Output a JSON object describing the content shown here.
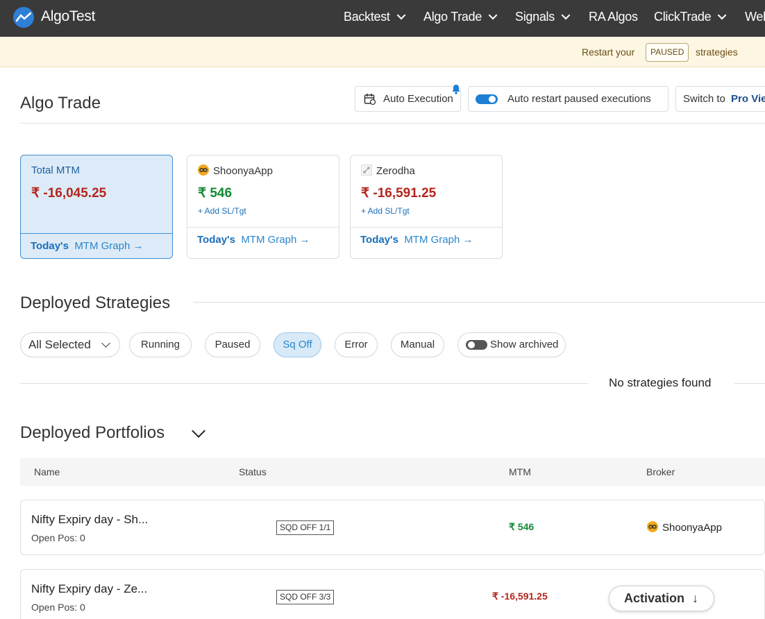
{
  "nav": {
    "brand": "AlgoTest",
    "items": [
      {
        "label": "Backtest"
      },
      {
        "label": "Algo Trade"
      },
      {
        "label": "Signals"
      },
      {
        "label": "RA Algos"
      },
      {
        "label": "ClickTrade"
      },
      {
        "label": "Web"
      }
    ]
  },
  "banner": {
    "prefix": "Restart your",
    "badge": "PAUSED",
    "suffix": "strategies"
  },
  "header": {
    "title": "Algo Trade",
    "auto_execution": "Auto Execution",
    "auto_restart": "Auto restart paused executions",
    "switch_to": "Switch to",
    "switch_target": "Pro Vie"
  },
  "mtm_cards": [
    {
      "label": "Total MTM",
      "amount": "₹ -16,045.25",
      "graph_bold": "Today's",
      "graph_text": "MTM Graph"
    },
    {
      "label": "ShoonyaApp",
      "amount": "₹ 546",
      "add": "+ Add SL/Tgt",
      "graph_bold": "Today's",
      "graph_text": "MTM Graph"
    },
    {
      "label": "Zerodha",
      "amount": "₹ -16,591.25",
      "add": "+ Add SL/Tgt",
      "graph_bold": "Today's",
      "graph_text": "MTM Graph"
    }
  ],
  "strategies": {
    "title": "Deployed Strategies",
    "filters": {
      "select": "All Selected",
      "pills": [
        "Running",
        "Paused",
        "Sq Off",
        "Error",
        "Manual"
      ],
      "active_pill": "Sq Off",
      "archived": "Show archived"
    },
    "empty": "No strategies found"
  },
  "portfolios": {
    "title": "Deployed Portfolios",
    "columns": [
      "Name",
      "Status",
      "MTM",
      "Broker"
    ],
    "rows": [
      {
        "name": "Nifty Expiry day - Sh...",
        "open_pos": "Open Pos: 0",
        "status": "SQD OFF 1/1",
        "mtm": "₹ 546",
        "broker": "ShoonyaApp"
      },
      {
        "name": "Nifty Expiry day - Ze...",
        "open_pos": "Open Pos: 0",
        "status": "SQD OFF 3/3",
        "mtm": "₹ -16,591.25",
        "broker": ""
      }
    ]
  },
  "activation": "Activation",
  "colors": {
    "nav_bg": "#3a3a3a",
    "accent": "#2a86c9",
    "loss": "#b3261e",
    "profit": "#138a36",
    "banner_bg": "#fdf6e3"
  }
}
